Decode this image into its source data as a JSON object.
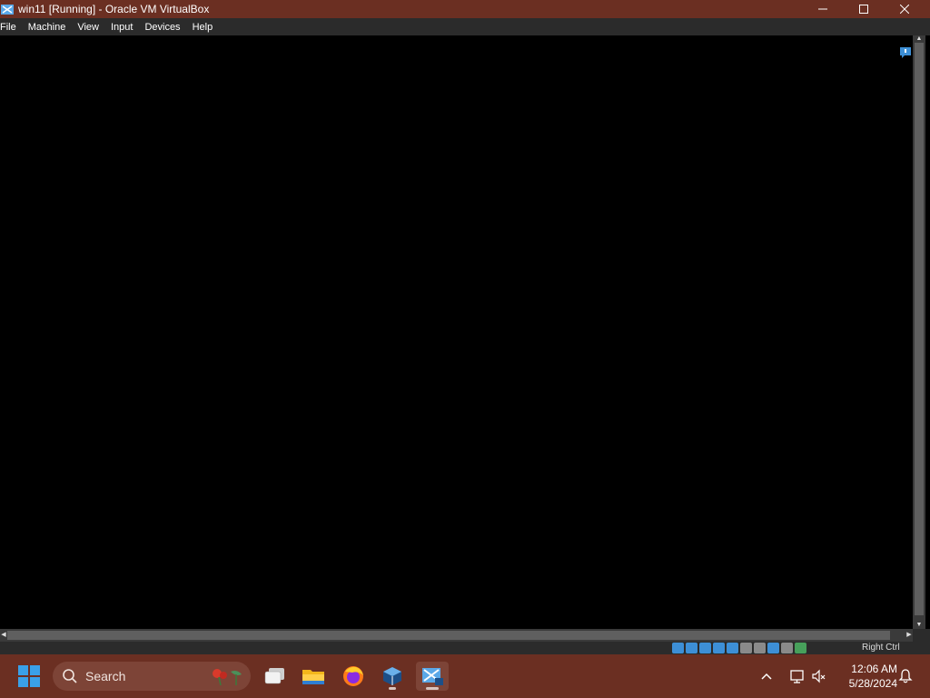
{
  "window": {
    "title": "win11 [Running] - Oracle VM VirtualBox",
    "controls": {
      "minimize": "–",
      "maximize": "☐",
      "close": "✕"
    }
  },
  "menu": [
    "File",
    "Machine",
    "View",
    "Input",
    "Devices",
    "Help"
  ],
  "vm": {
    "status_icons": [
      "optical-drive-icon",
      "usb-icon",
      "shared-folders-icon",
      "network-icon",
      "drag-drop-icon",
      "recording-icon",
      "display-icon",
      "mouse-integration-icon",
      "cpu-icon",
      "host-key-icon"
    ],
    "host_key": "Right Ctrl"
  },
  "taskbar": {
    "search_placeholder": "Search",
    "apps": [
      "task-view-icon",
      "file-explorer-icon",
      "firefox-icon",
      "virtualbox-manager-icon",
      "virtualbox-vm-icon"
    ],
    "clock": {
      "time": "12:06 AM",
      "date": "5/28/2024"
    }
  },
  "colors": {
    "titlebar": "#6b2f22",
    "menubar": "#2b2b2b",
    "accent": "#3d8fd6"
  }
}
